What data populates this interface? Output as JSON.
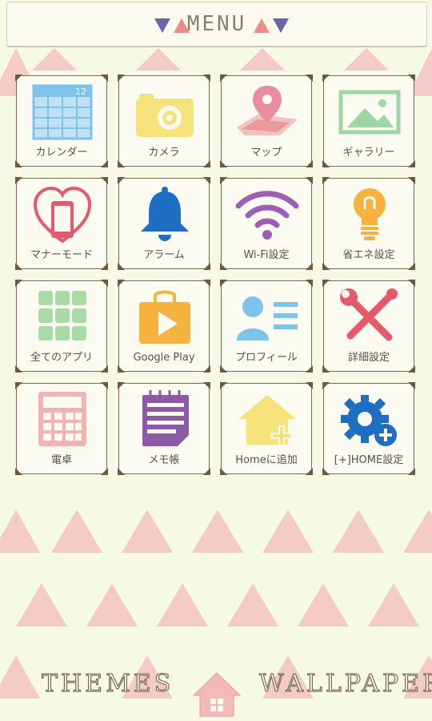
{
  "header": {
    "title": "MENU"
  },
  "tiles": [
    {
      "label": "カレンダー",
      "icon": "calendar-icon",
      "badge": "12"
    },
    {
      "label": "カメラ",
      "icon": "camera-icon"
    },
    {
      "label": "マップ",
      "icon": "map-icon"
    },
    {
      "label": "ギャラリー",
      "icon": "gallery-icon"
    },
    {
      "label": "マナーモード",
      "icon": "manner-mode-icon"
    },
    {
      "label": "アラーム",
      "icon": "alarm-bell-icon"
    },
    {
      "label": "Wi-Fi設定",
      "icon": "wifi-icon"
    },
    {
      "label": "省エネ設定",
      "icon": "lightbulb-icon"
    },
    {
      "label": "全てのアプリ",
      "icon": "all-apps-icon"
    },
    {
      "label": "Google Play",
      "icon": "google-play-icon"
    },
    {
      "label": "プロフィール",
      "icon": "profile-icon"
    },
    {
      "label": "詳細設定",
      "icon": "tools-icon"
    },
    {
      "label": "電卓",
      "icon": "calculator-icon"
    },
    {
      "label": "メモ帳",
      "icon": "notepad-icon"
    },
    {
      "label": "Homeに追加",
      "icon": "add-home-icon"
    },
    {
      "label": "[+]HOME設定",
      "icon": "home-settings-icon"
    }
  ],
  "footer": {
    "themes_label": "THEMES",
    "wallpaper_label": "WALLPAPER"
  },
  "colors": {
    "background": "#f6f9e6",
    "triangle": "#f4b9b9",
    "frame": "#7a6a55",
    "header_purple": "#6f62a8",
    "header_pink": "#ef8a8a"
  }
}
